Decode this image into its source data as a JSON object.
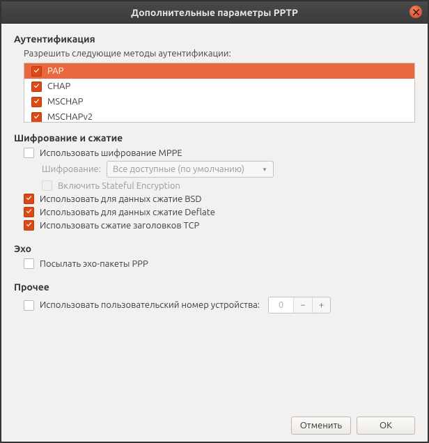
{
  "window": {
    "title": "Дополнительные параметры PPTP"
  },
  "auth": {
    "section_title": "Аутентификация",
    "hint": "Разрешить следующие методы аутентификации:",
    "items": [
      {
        "label": "PAP"
      },
      {
        "label": "CHAP"
      },
      {
        "label": "MSCHAP"
      },
      {
        "label": "MSCHAPv2"
      }
    ]
  },
  "encryption": {
    "section_title": "Шифрование и сжатие",
    "mppe_label": "Использовать шифрование MPPE",
    "security_label": "Шифрование:",
    "dropdown_value": "Все доступные (по умолчанию)",
    "stateful_label": "Включить Stateful Encryption",
    "bsd_label": "Использовать для данных сжатие BSD",
    "deflate_label": "Использовать для данных сжатие Deflate",
    "tcp_label": "Использовать сжатие заголовков TCP"
  },
  "echo": {
    "section_title": "Эхо",
    "send_label": "Посылать эхо-пакеты PPP"
  },
  "misc": {
    "section_title": "Прочее",
    "unit_label": "Использовать пользовательский номер устройства:",
    "unit_value": "0"
  },
  "buttons": {
    "cancel": "Отменить",
    "ok": "ОК"
  }
}
